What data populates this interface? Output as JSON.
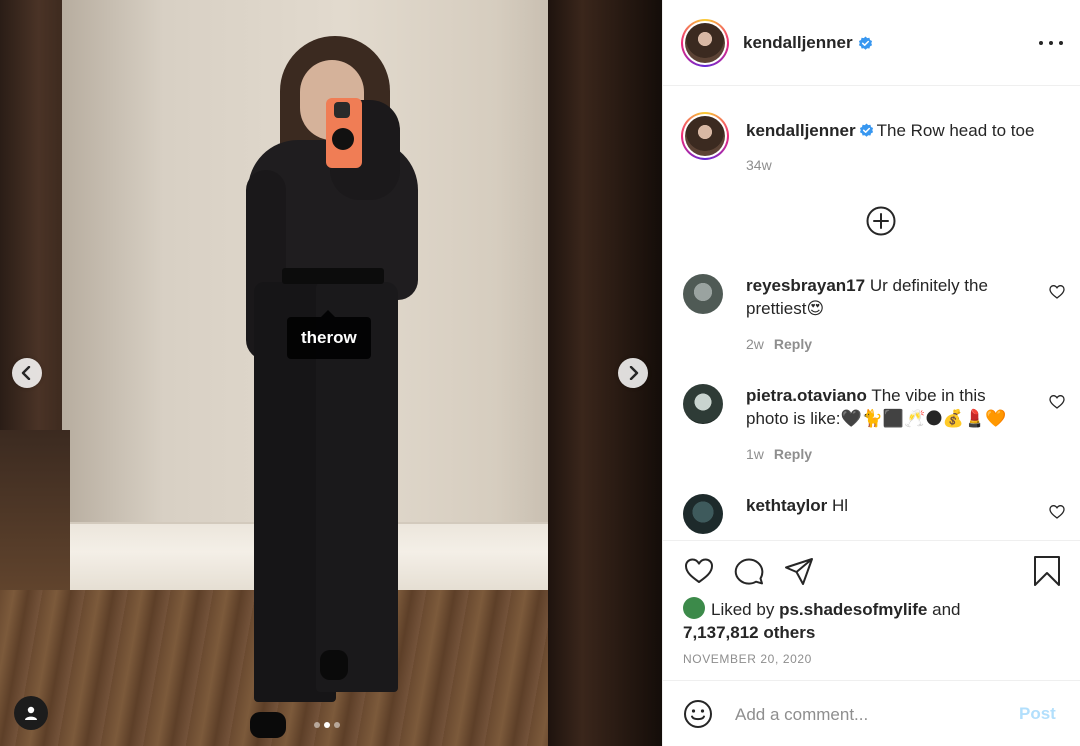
{
  "photo": {
    "tag_label": "therow",
    "carousel_count": 3,
    "carousel_active": 2,
    "icons": {
      "prev": "chevron-left-icon",
      "next": "chevron-right-icon",
      "user_tag": "user-icon"
    }
  },
  "header": {
    "username": "kendalljenner",
    "verified_icon": "verified-badge-icon",
    "more_icon": "more-icon"
  },
  "caption": {
    "username": "kendalljenner",
    "text": "The Row head to toe",
    "time": "34w"
  },
  "comments": [
    {
      "username": "reyesbrayan17",
      "text": "Ur definitely the prettiest😍",
      "time": "2w",
      "reply": "Reply"
    },
    {
      "username": "pietra.otaviano",
      "text": "The vibe in this photo is like:🖤🐈⬛🥂🌑💰💄🧡",
      "time": "1w",
      "reply": "Reply"
    },
    {
      "username": "kethtaylor",
      "text": "Hl",
      "time": "",
      "reply": ""
    }
  ],
  "actions": {
    "icons": [
      "heart-icon",
      "comment-icon",
      "share-icon",
      "bookmark-icon"
    ],
    "liked_prefix": "Liked by",
    "liked_user": "ps.shadesofmylife",
    "liked_and": "and",
    "liked_others": "7,137,812 others",
    "date": "NOVEMBER 20, 2020"
  },
  "add_comment": {
    "placeholder": "Add a comment...",
    "post_label": "Post"
  },
  "colors": {
    "verified": "#3897f0",
    "post_disabled": "#b2dffc",
    "muted_text": "#8e8e8e"
  }
}
